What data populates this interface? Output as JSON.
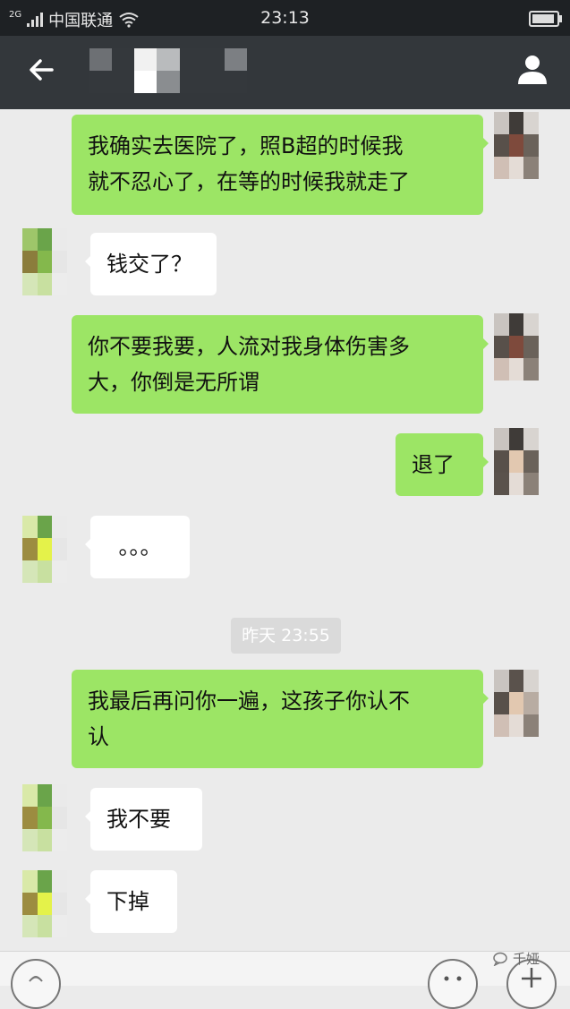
{
  "status_bar": {
    "network_type": "2G",
    "carrier": "中国联通",
    "time": "23:13",
    "icons": [
      "signal-icon",
      "wifi-icon",
      "battery-icon"
    ]
  },
  "header": {
    "contact_name": "",
    "icons": [
      "back-arrow-icon",
      "profile-icon"
    ]
  },
  "messages": [
    {
      "side": "me",
      "text_line1": "我确实去医院了，照B超的时候我",
      "text_line2": "就不忍心了，在等的时候我就走了"
    },
    {
      "side": "other",
      "text": "钱交了？"
    },
    {
      "side": "me",
      "text_line1": "你不要我要，人流对我身体伤害多",
      "text_line2": "大，你倒是无所谓"
    },
    {
      "side": "me",
      "text": "退了"
    },
    {
      "side": "other",
      "text": "。。。"
    },
    {
      "side": "me",
      "text_line1": "我最后再问你一遍，这孩子你认不",
      "text_line2": "认"
    },
    {
      "side": "other",
      "text": "我不要"
    },
    {
      "side": "other",
      "text": "下掉"
    }
  ],
  "timestamp": "昨天 23:55",
  "input_bar": {
    "icons": [
      "voice-icon",
      "emoji-icon",
      "plus-icon"
    ]
  },
  "watermark": "千娅",
  "colors": {
    "my_bubble": "#9ce565",
    "other_bubble": "#ffffff",
    "background": "#ebebeb",
    "title_bar": "#33373b"
  }
}
